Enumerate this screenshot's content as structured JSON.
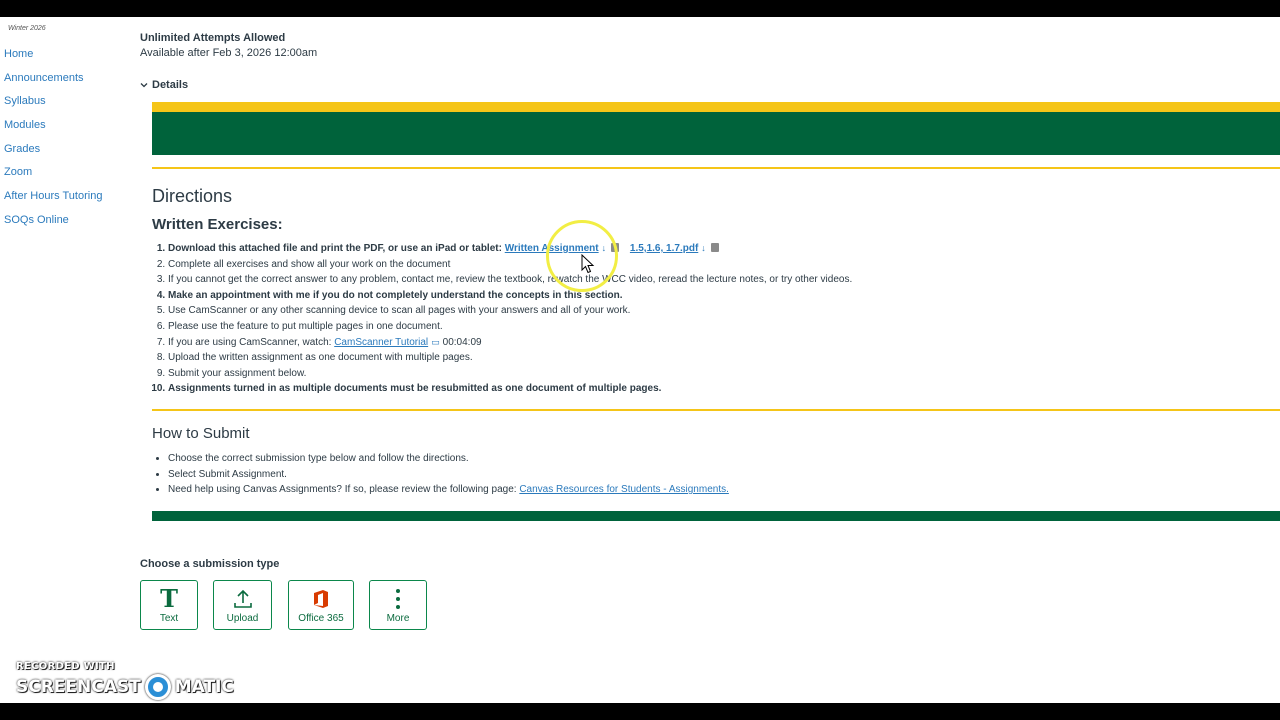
{
  "sidebar": {
    "term": "Winter 2026",
    "items": [
      {
        "label": "Home"
      },
      {
        "label": "Announcements"
      },
      {
        "label": "Syllabus"
      },
      {
        "label": "Modules"
      },
      {
        "label": "Grades"
      },
      {
        "label": "Zoom"
      },
      {
        "label": "After Hours Tutoring"
      },
      {
        "label": "SOQs Online"
      }
    ]
  },
  "assignment": {
    "attempts": "Unlimited Attempts Allowed",
    "available": "Available after Feb 3, 2026 12:00am",
    "details_label": "Details"
  },
  "content": {
    "directions_heading": "Directions",
    "written_heading": "Written Exercises:",
    "steps": [
      {
        "text": "Download this attached file and print the PDF, or use an iPad or tablet: ",
        "link1": "Written Assignment",
        "link2": "1.5,1.6, 1.7.pdf"
      },
      {
        "text": "Complete all exercises and show all your work on the document"
      },
      {
        "text": "If you cannot get the correct answer to any problem, contact me, review the textbook, rewatch the WCC video, reread the lecture notes, or try other videos."
      },
      {
        "text": "Make an appointment with me if you do not completely understand the concepts in this section."
      },
      {
        "text": "Use CamScanner or any other scanning device to scan all pages with your answers and all of your work."
      },
      {
        "text": "Please use the feature to put multiple pages in one document."
      },
      {
        "text": "If you are using CamScanner, watch: ",
        "link1": "CamScanner Tutorial",
        "duration": "00:04:09"
      },
      {
        "text": "Upload the written assignment as one document with multiple pages."
      },
      {
        "text": "Submit your assignment below."
      },
      {
        "text": "Assignments turned in as multiple documents must be resubmitted as one document of multiple pages."
      }
    ],
    "how_heading": "How to Submit",
    "how_items": [
      {
        "text": "Choose the correct submission type below and follow the directions."
      },
      {
        "text": "Select Submit Assignment."
      },
      {
        "text": "Need help using Canvas Assignments? If so, please review the following page: ",
        "link1": "Canvas Resources for Students - Assignments."
      }
    ]
  },
  "submission": {
    "label": "Choose a submission type",
    "types": [
      {
        "label": "Text",
        "icon": "text-T-icon"
      },
      {
        "label": "Upload",
        "icon": "upload-icon"
      },
      {
        "label": "Office 365",
        "icon": "office-365-icon"
      },
      {
        "label": "More",
        "icon": "kebab-menu-icon"
      }
    ]
  },
  "watermark": {
    "line1": "RECORDED WITH",
    "brand_left": "SCREENCAST",
    "brand_right": "MATIC"
  },
  "colors": {
    "brand_green": "#00633b",
    "brand_yellow": "#f5c518",
    "link_blue": "#2b7abc",
    "button_green": "#0b874b",
    "office_orange": "#d83b01"
  }
}
